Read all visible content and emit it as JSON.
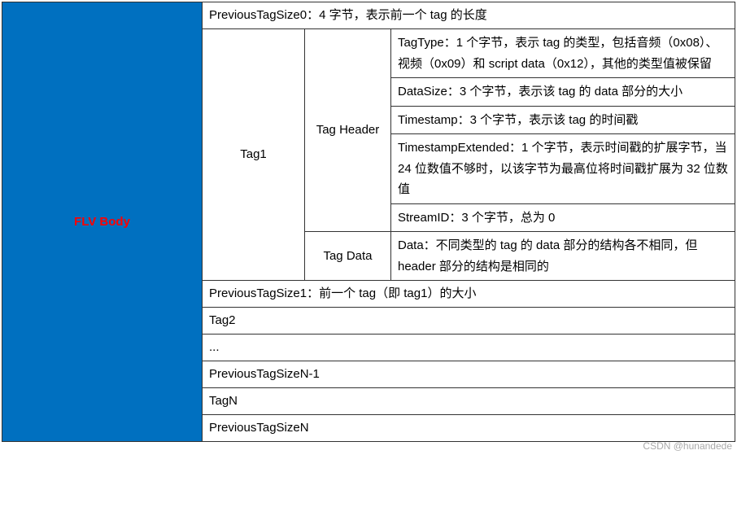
{
  "flvBody": {
    "label": "FLV Body",
    "rows": {
      "prevTagSize0": "PreviousTagSize0：4 字节，表示前一个 tag 的长度",
      "tag1": {
        "label": "Tag1",
        "header": {
          "label": "Tag Header",
          "fields": {
            "tagType": "TagType：1 个字节，表示 tag 的类型，包括音频（0x08）、视频（0x09）和 script data（0x12），其他的类型值被保留",
            "dataSize": "DataSize：3 个字节，表示该 tag 的 data 部分的大小",
            "timestamp": "Timestamp：3 个字节，表示该 tag 的时间戳",
            "timestampExtended": "TimestampExtended：1 个字节，表示时间戳的扩展字节，当 24 位数值不够时，以该字节为最高位将时间戳扩展为 32 位数值",
            "streamId": "StreamID：3 个字节，总为 0"
          }
        },
        "data": {
          "label": "Tag Data",
          "content": "Data：不同类型的 tag 的 data 部分的结构各不相同，但 header 部分的结构是相同的"
        }
      },
      "prevTagSize1": "PreviousTagSize1：前一个 tag（即 tag1）的大小",
      "tag2": "Tag2",
      "ellipsis": "...",
      "prevTagSizeNMinus1": "PreviousTagSizeN-1",
      "tagN": "TagN",
      "prevTagSizeN": "PreviousTagSizeN"
    }
  },
  "watermark": "CSDN @hunandede"
}
